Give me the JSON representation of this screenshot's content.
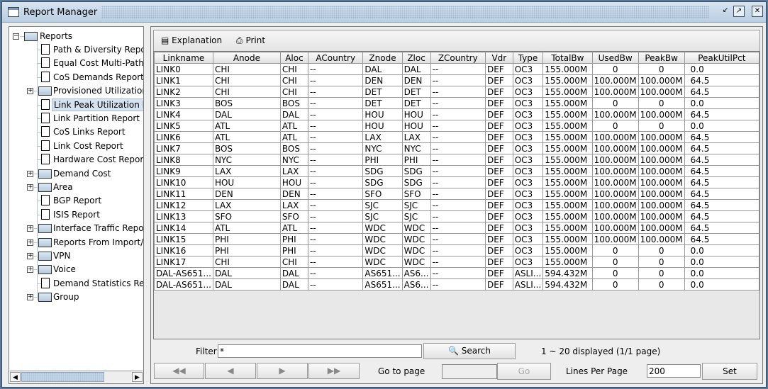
{
  "window": {
    "title": "Report Manager",
    "controls": [
      "minimize",
      "maximize",
      "close"
    ]
  },
  "tree": {
    "root": "Reports",
    "items": [
      {
        "label": "Path & Diversity Report",
        "type": "file"
      },
      {
        "label": "Equal Cost Multi-Path Report",
        "type": "file"
      },
      {
        "label": "CoS Demands Report",
        "type": "file"
      },
      {
        "label": "Provisioned Utilization Report",
        "type": "folder"
      },
      {
        "label": "Link Peak Utilization Report",
        "type": "file",
        "selected": true
      },
      {
        "label": "Link Partition Report",
        "type": "file"
      },
      {
        "label": "CoS Links Report",
        "type": "file"
      },
      {
        "label": "Link Cost Report",
        "type": "file"
      },
      {
        "label": "Hardware Cost Report",
        "type": "file"
      },
      {
        "label": "Demand Cost",
        "type": "folder"
      },
      {
        "label": "Area",
        "type": "folder"
      },
      {
        "label": "BGP Report",
        "type": "file"
      },
      {
        "label": "ISIS Report",
        "type": "file"
      },
      {
        "label": "Interface Traffic Reports",
        "type": "folder"
      },
      {
        "label": "Reports From Import/Live",
        "type": "folder"
      },
      {
        "label": "VPN",
        "type": "folder"
      },
      {
        "label": "Voice",
        "type": "folder"
      },
      {
        "label": "Demand Statistics Report",
        "type": "file"
      },
      {
        "label": "Group",
        "type": "folder"
      }
    ]
  },
  "toolbar": {
    "explanation": "Explanation",
    "print": "Print"
  },
  "table": {
    "columns": [
      "Linkname",
      "Anode",
      "Aloc",
      "ACountry",
      "Znode",
      "Zloc",
      "ZCountry",
      "Vdr",
      "Type",
      "TotalBw",
      "UsedBw",
      "PeakBw",
      "PeakUtilPct"
    ],
    "rows": [
      [
        "LINK0",
        "CHI",
        "CHI",
        "--",
        "DAL",
        "DAL",
        "--",
        "DEF",
        "OC3",
        "155.000M",
        "0",
        "0",
        "0.0"
      ],
      [
        "LINK1",
        "CHI",
        "CHI",
        "--",
        "DEN",
        "DEN",
        "--",
        "DEF",
        "OC3",
        "155.000M",
        "100.000M",
        "100.000M",
        "64.5"
      ],
      [
        "LINK2",
        "CHI",
        "CHI",
        "--",
        "DET",
        "DET",
        "--",
        "DEF",
        "OC3",
        "155.000M",
        "100.000M",
        "100.000M",
        "64.5"
      ],
      [
        "LINK3",
        "BOS",
        "BOS",
        "--",
        "DET",
        "DET",
        "--",
        "DEF",
        "OC3",
        "155.000M",
        "0",
        "0",
        "0.0"
      ],
      [
        "LINK4",
        "DAL",
        "DAL",
        "--",
        "HOU",
        "HOU",
        "--",
        "DEF",
        "OC3",
        "155.000M",
        "100.000M",
        "100.000M",
        "64.5"
      ],
      [
        "LINK5",
        "ATL",
        "ATL",
        "--",
        "HOU",
        "HOU",
        "--",
        "DEF",
        "OC3",
        "155.000M",
        "0",
        "0",
        "0.0"
      ],
      [
        "LINK6",
        "ATL",
        "ATL",
        "--",
        "LAX",
        "LAX",
        "--",
        "DEF",
        "OC3",
        "155.000M",
        "100.000M",
        "100.000M",
        "64.5"
      ],
      [
        "LINK7",
        "BOS",
        "BOS",
        "--",
        "NYC",
        "NYC",
        "--",
        "DEF",
        "OC3",
        "155.000M",
        "100.000M",
        "100.000M",
        "64.5"
      ],
      [
        "LINK8",
        "NYC",
        "NYC",
        "--",
        "PHI",
        "PHI",
        "--",
        "DEF",
        "OC3",
        "155.000M",
        "100.000M",
        "100.000M",
        "64.5"
      ],
      [
        "LINK9",
        "LAX",
        "LAX",
        "--",
        "SDG",
        "SDG",
        "--",
        "DEF",
        "OC3",
        "155.000M",
        "100.000M",
        "100.000M",
        "64.5"
      ],
      [
        "LINK10",
        "HOU",
        "HOU",
        "--",
        "SDG",
        "SDG",
        "--",
        "DEF",
        "OC3",
        "155.000M",
        "100.000M",
        "100.000M",
        "64.5"
      ],
      [
        "LINK11",
        "DEN",
        "DEN",
        "--",
        "SFO",
        "SFO",
        "--",
        "DEF",
        "OC3",
        "155.000M",
        "100.000M",
        "100.000M",
        "64.5"
      ],
      [
        "LINK12",
        "LAX",
        "LAX",
        "--",
        "SJC",
        "SJC",
        "--",
        "DEF",
        "OC3",
        "155.000M",
        "100.000M",
        "100.000M",
        "64.5"
      ],
      [
        "LINK13",
        "SFO",
        "SFO",
        "--",
        "SJC",
        "SJC",
        "--",
        "DEF",
        "OC3",
        "155.000M",
        "100.000M",
        "100.000M",
        "64.5"
      ],
      [
        "LINK14",
        "ATL",
        "ATL",
        "--",
        "WDC",
        "WDC",
        "--",
        "DEF",
        "OC3",
        "155.000M",
        "100.000M",
        "100.000M",
        "64.5"
      ],
      [
        "LINK15",
        "PHI",
        "PHI",
        "--",
        "WDC",
        "WDC",
        "--",
        "DEF",
        "OC3",
        "155.000M",
        "100.000M",
        "100.000M",
        "64.5"
      ],
      [
        "LINK16",
        "PHI",
        "PHI",
        "--",
        "WDC",
        "WDC",
        "--",
        "DEF",
        "OC3",
        "155.000M",
        "0",
        "0",
        "0.0"
      ],
      [
        "LINK17",
        "CHI",
        "CHI",
        "--",
        "WDC",
        "WDC",
        "--",
        "DEF",
        "OC3",
        "155.000M",
        "0",
        "0",
        "0.0"
      ],
      [
        "DAL-AS651...",
        "DAL",
        "DAL",
        "--",
        "AS651...",
        "AS6...",
        "--",
        "DEF",
        "ASLI...",
        "594.432M",
        "0",
        "0",
        "0.0"
      ],
      [
        "DAL-AS651...",
        "DAL",
        "DAL",
        "--",
        "AS651...",
        "AS6...",
        "--",
        "DEF",
        "ASLI...",
        "594.432M",
        "0",
        "0",
        "0.0"
      ]
    ]
  },
  "footer": {
    "filter_label": "Filter:",
    "filter_value": "*",
    "search": "Search",
    "status": "1 ~ 20 displayed (1/1 page)",
    "goto_label": "Go to page",
    "goto_value": "",
    "go": "Go",
    "lines_label": "Lines Per Page",
    "lines_value": "200",
    "set": "Set"
  }
}
